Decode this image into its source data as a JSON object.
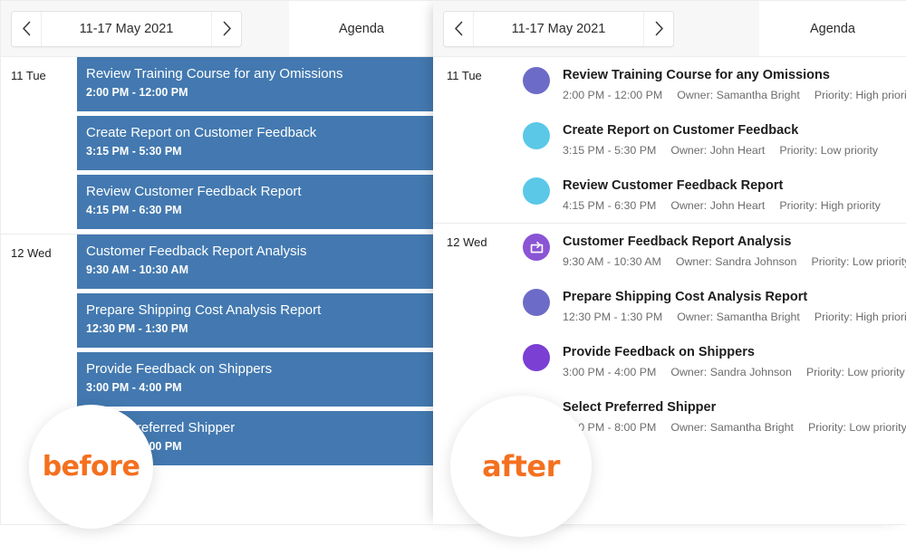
{
  "colors": {
    "appointment_blue": "#4379b0",
    "toolbar_bg": "#f7f7f7",
    "accent_orange": "#f4701f",
    "marker_periwinkle": "#6c6cc8",
    "marker_cyan": "#5bc8e8",
    "marker_violet": "#7b3fd4",
    "marker_purple": "#8a54d4"
  },
  "before": {
    "toolbar": {
      "prev_label": "‹",
      "next_label": "›",
      "date_range": "11-17 May 2021",
      "view_tab": "Agenda"
    },
    "days": [
      {
        "day_label": "11 Tue",
        "events": [
          {
            "title": "Review Training Course for any Omissions",
            "time": "2:00 PM - 12:00 PM"
          },
          {
            "title": "Create Report on Customer Feedback",
            "time": "3:15 PM - 5:30 PM"
          },
          {
            "title": "Review Customer Feedback Report",
            "time": "4:15 PM - 6:30 PM"
          }
        ]
      },
      {
        "day_label": "12 Wed",
        "events": [
          {
            "title": "Customer Feedback Report Analysis",
            "time": "9:30 AM - 10:30 AM"
          },
          {
            "title": "Prepare Shipping Cost Analysis Report",
            "time": "12:30 PM - 1:30 PM"
          },
          {
            "title": "Provide Feedback on Shippers",
            "time": "3:00 PM - 4:00 PM"
          },
          {
            "title": "Select Preferred Shipper",
            "time": "7:00 PM - 8:00 PM"
          }
        ]
      }
    ],
    "badge_label": "before"
  },
  "after": {
    "toolbar": {
      "prev_label": "‹",
      "next_label": "›",
      "date_range": "11-17 May 2021",
      "view_tab": "Agenda"
    },
    "days": [
      {
        "day_label": "11 Tue",
        "events": [
          {
            "title": "Review Training Course for any Omissions",
            "time": "2:00 PM - 12:00 PM",
            "owner": "Owner: Samantha Bright",
            "priority": "Priority: High priority",
            "marker_color": "#6c6cc8",
            "marker_icon": "none"
          },
          {
            "title": "Create Report on Customer Feedback",
            "time": "3:15 PM - 5:30 PM",
            "owner": "Owner: John Heart",
            "priority": "Priority: Low priority",
            "marker_color": "#5bc8e8",
            "marker_icon": "none"
          },
          {
            "title": "Review Customer Feedback Report",
            "time": "4:15 PM - 6:30 PM",
            "owner": "Owner: John Heart",
            "priority": "Priority: High priority",
            "marker_color": "#5bc8e8",
            "marker_icon": "none"
          }
        ]
      },
      {
        "day_label": "12 Wed",
        "events": [
          {
            "title": "Customer Feedback Report Analysis",
            "time": "9:30 AM - 10:30 AM",
            "owner": "Owner: Sandra Johnson",
            "priority": "Priority: Low priority",
            "marker_color": "#8a54d4",
            "marker_icon": "forward-box-icon"
          },
          {
            "title": "Prepare Shipping Cost Analysis Report",
            "time": "12:30 PM - 1:30 PM",
            "owner": "Owner: Samantha Bright",
            "priority": "Priority: High priority",
            "marker_color": "#6c6cc8",
            "marker_icon": "none"
          },
          {
            "title": "Provide Feedback on Shippers",
            "time": "3:00 PM - 4:00 PM",
            "owner": "Owner: Sandra Johnson",
            "priority": "Priority: Low priority",
            "marker_color": "#7b3fd4",
            "marker_icon": "none"
          },
          {
            "title": "Select Preferred Shipper",
            "time": "7:00 PM - 8:00 PM",
            "owner": "Owner: Samantha Bright",
            "priority": "Priority: Low priority",
            "marker_color": "#7b3fd4",
            "marker_icon": "none"
          }
        ]
      }
    ],
    "badge_label": "after"
  }
}
